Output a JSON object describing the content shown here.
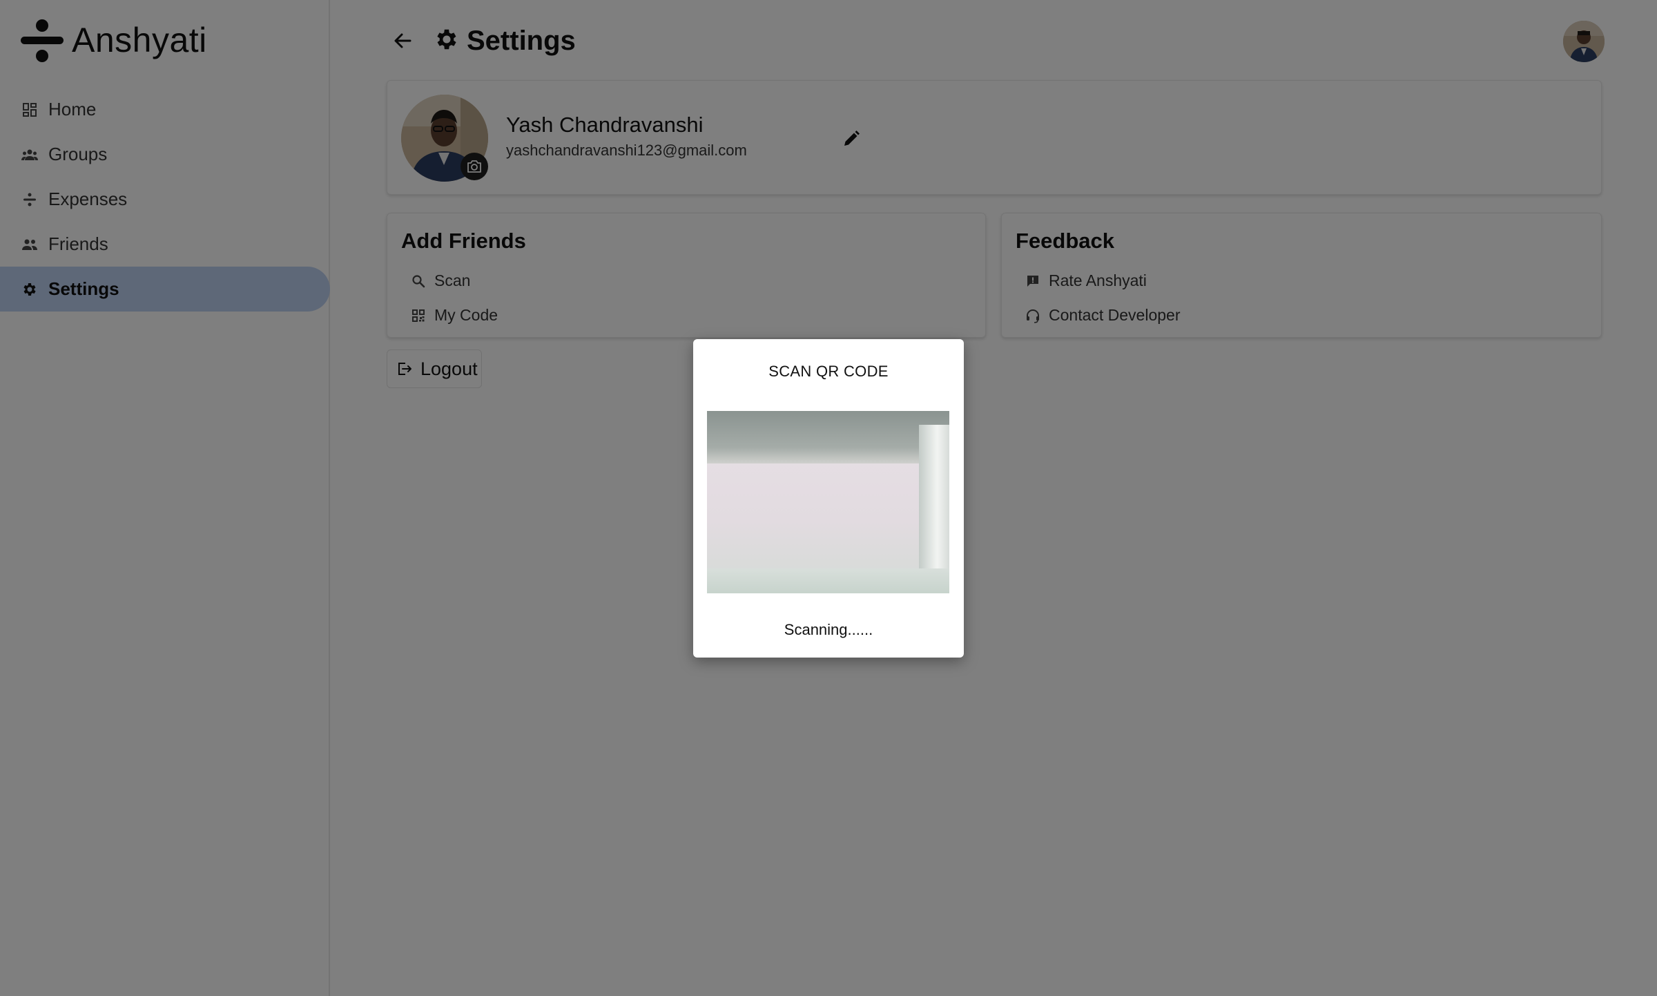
{
  "app": {
    "name": "Anshyati"
  },
  "sidebar": {
    "items": [
      {
        "label": "Home",
        "icon": "dashboard-icon",
        "active": false
      },
      {
        "label": "Groups",
        "icon": "groups-icon",
        "active": false
      },
      {
        "label": "Expenses",
        "icon": "expense-icon",
        "active": false
      },
      {
        "label": "Friends",
        "icon": "friends-icon",
        "active": false
      },
      {
        "label": "Settings",
        "icon": "gear-icon",
        "active": true
      }
    ]
  },
  "header": {
    "title": "Settings",
    "back_icon": "arrow-left-icon",
    "title_icon": "gear-icon"
  },
  "profile": {
    "name": "Yash Chandravanshi",
    "email": "yashchandravanshi123@gmail.com",
    "edit_icon": "pencil-icon",
    "camera_icon": "camera-icon"
  },
  "add_friends": {
    "title": "Add Friends",
    "links": [
      {
        "label": "Scan",
        "icon": "search-icon"
      },
      {
        "label": "My Code",
        "icon": "qr-code-icon"
      }
    ]
  },
  "feedback": {
    "title": "Feedback",
    "links": [
      {
        "label": "Rate Anshyati",
        "icon": "feedback-icon"
      },
      {
        "label": "Contact Developer",
        "icon": "headset-icon"
      }
    ]
  },
  "logout": {
    "label": "Logout",
    "icon": "logout-icon"
  },
  "modal": {
    "title": "SCAN QR CODE",
    "status": "Scanning......"
  },
  "colors": {
    "active_nav_bg": "#bcd0f0",
    "overlay": "rgba(0,0,0,0.5)"
  }
}
